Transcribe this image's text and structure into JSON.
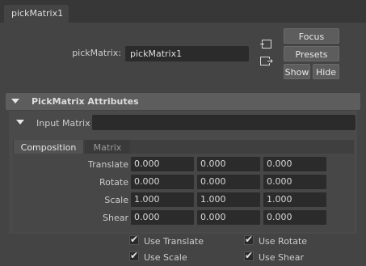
{
  "tab": {
    "title": "pickMatrix1"
  },
  "node": {
    "label": "pickMatrix:",
    "value": "pickMatrix1"
  },
  "buttons": {
    "focus": "Focus",
    "presets": "Presets",
    "show": "Show",
    "hide": "Hide"
  },
  "section": {
    "title": "PickMatrix Attributes"
  },
  "input_matrix": {
    "label": "Input Matrix",
    "value": ""
  },
  "subtabs": {
    "composition": "Composition",
    "matrix": "Matrix"
  },
  "rows": [
    {
      "label": "Translate",
      "values": [
        "0.000",
        "0.000",
        "0.000"
      ]
    },
    {
      "label": "Rotate",
      "values": [
        "0.000",
        "0.000",
        "0.000"
      ]
    },
    {
      "label": "Scale",
      "values": [
        "1.000",
        "1.000",
        "1.000"
      ]
    },
    {
      "label": "Shear",
      "values": [
        "0.000",
        "0.000",
        "0.000"
      ]
    }
  ],
  "checkboxes": [
    {
      "label": "Use Translate",
      "checked": true
    },
    {
      "label": "Use Rotate",
      "checked": true
    },
    {
      "label": "Use Scale",
      "checked": true
    },
    {
      "label": "Use Shear",
      "checked": true
    }
  ],
  "icons": {
    "input_connection": "input-connection-icon",
    "output_connection": "output-connection-icon",
    "collapse": "triangle-down-icon",
    "checkmark": "checkmark-icon"
  },
  "colors": {
    "background": "#444444",
    "field": "#2b2b2b",
    "header": "#5d5d5d"
  }
}
